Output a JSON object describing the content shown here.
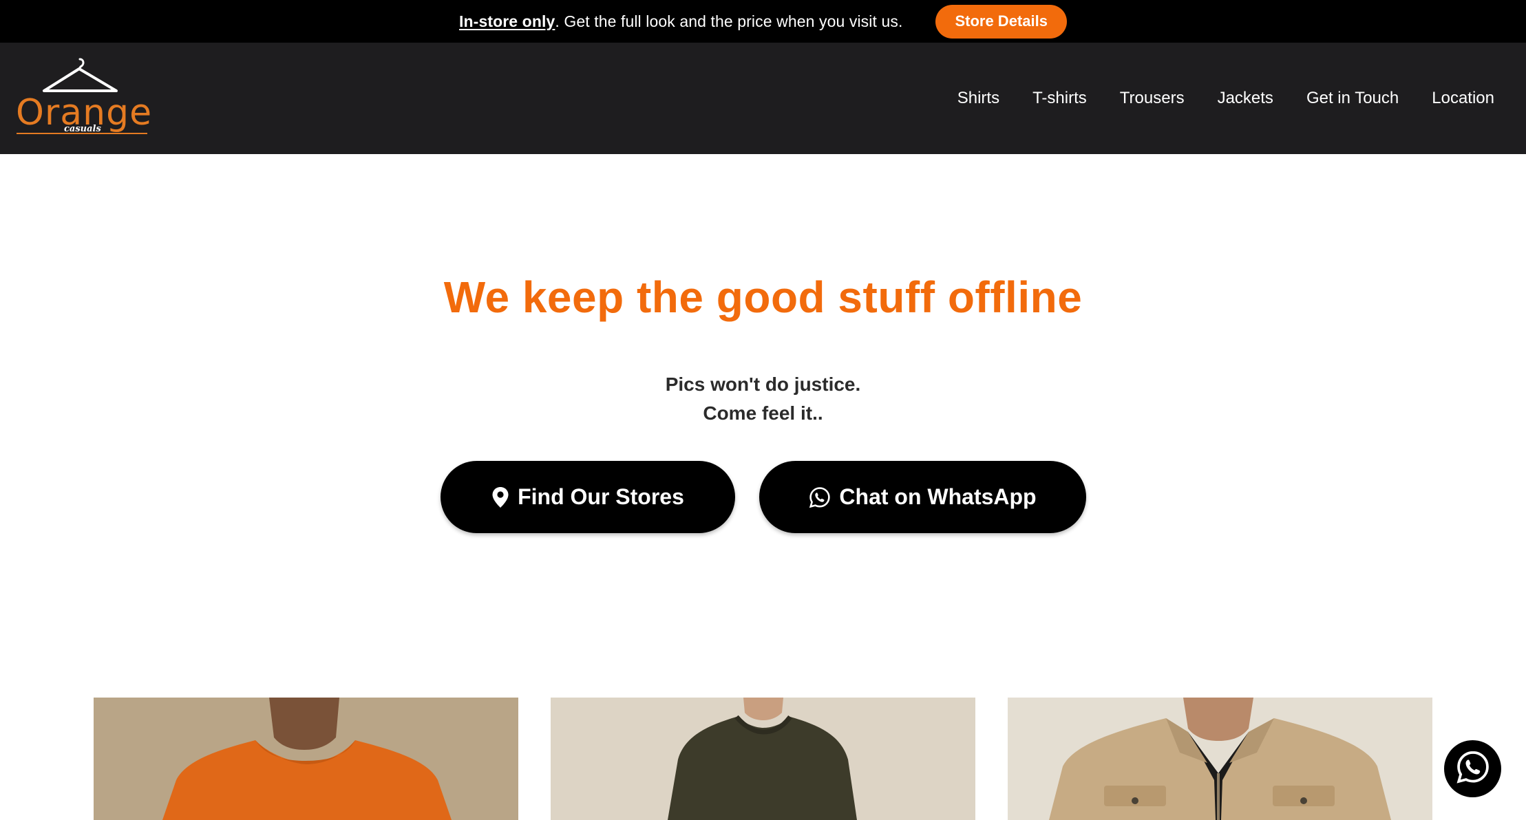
{
  "announcement": {
    "strong_text": "In-store only",
    "text": ". Get the full look and the price when you visit us.",
    "button_label": "Store Details"
  },
  "brand": {
    "name": "Orange",
    "tagline": "casuals",
    "accent_color": "#f26b0c"
  },
  "nav": {
    "items": [
      "Shirts",
      "T-shirts",
      "Trousers",
      "Jackets",
      "Get in Touch",
      "Location"
    ]
  },
  "hero": {
    "title": "We keep the good stuff offline",
    "subtitle_line1": "Pics won't do justice.",
    "subtitle_line2": "Come feel it..",
    "cta_stores": "Find Our Stores",
    "cta_stores_icon": "map-pin-icon",
    "cta_whatsapp": "Chat on WhatsApp",
    "cta_whatsapp_icon": "whatsapp-icon"
  },
  "products": [
    {
      "image": "orange-tshirt-photo"
    },
    {
      "image": "olive-sweater-photo"
    },
    {
      "image": "khaki-jacket-photo"
    }
  ],
  "floating_button": {
    "icon": "whatsapp-icon"
  }
}
